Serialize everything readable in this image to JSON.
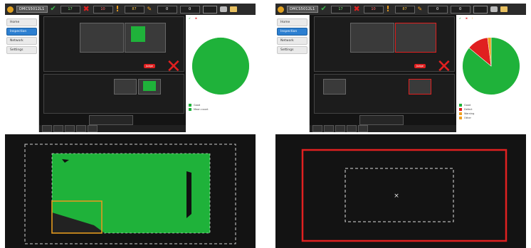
{
  "left": {
    "toolbar": {
      "title": "DMCS5012L1",
      "counters": {
        "ok": "17",
        "ng": "10",
        "warn": "87",
        "setup": "0",
        "other": "0"
      }
    },
    "sidebar": {
      "items": [
        {
          "label": "Home",
          "active": false
        },
        {
          "label": "Inspection",
          "active": true
        },
        {
          "label": "Network",
          "active": false
        },
        {
          "label": "Settings",
          "active": false
        }
      ]
    },
    "stats": {
      "pie_slices": [
        {
          "label": "Good",
          "value": 100,
          "color": "#1fb23a"
        }
      ],
      "legend": [
        {
          "label": "Good",
          "value": "",
          "color": "#1fb23a"
        },
        {
          "label": "Mean count",
          "value": "",
          "color": "#1fb23a"
        }
      ]
    },
    "judge_label": "Judge",
    "colors": {
      "good": "#1fb23a",
      "ng": "#e02020",
      "roi_orange": "#e39a1f"
    }
  },
  "right": {
    "toolbar": {
      "title": "DMCS5012L1",
      "counters": {
        "ok": "17",
        "ng": "10",
        "warn": "87",
        "setup": "0",
        "other": "0"
      }
    },
    "sidebar": {
      "items": [
        {
          "label": "Home",
          "active": false
        },
        {
          "label": "Inspection",
          "active": true
        },
        {
          "label": "Network",
          "active": false
        },
        {
          "label": "Settings",
          "active": false
        }
      ]
    },
    "stats": {
      "pie_slices": [
        {
          "label": "Good",
          "value": 86,
          "color": "#1fb23a"
        },
        {
          "label": "Defect",
          "value": 12,
          "color": "#e02020"
        },
        {
          "label": "Warning",
          "value": 2,
          "color": "#f0a020"
        }
      ],
      "legend": [
        {
          "label": "Good",
          "value": "",
          "color": "#1fb23a"
        },
        {
          "label": "Defect",
          "value": "",
          "color": "#e02020"
        },
        {
          "label": "Warning",
          "value": "",
          "color": "#f0a020"
        },
        {
          "label": "Other",
          "value": "",
          "color": "#f0a020"
        }
      ]
    },
    "judge_label": "Judge",
    "colors": {
      "good": "#1fb23a",
      "ng": "#e02020",
      "roi_white": "#dddddd"
    }
  }
}
